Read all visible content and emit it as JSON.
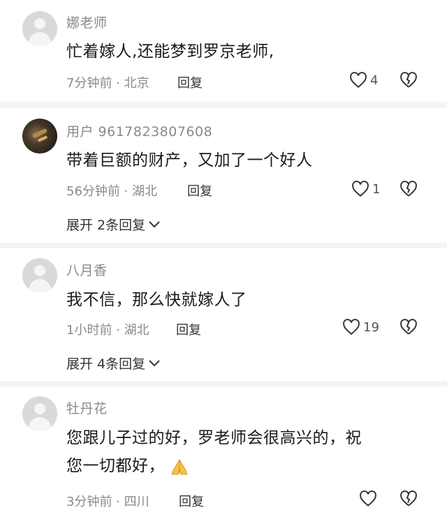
{
  "comments": [
    {
      "user": "娜老师",
      "text": "忙着嫁人,还能梦到罗京老师,",
      "meta": "7分钟前 · 北京",
      "reply": "回复",
      "likes": "4",
      "avatar": "default-avatar"
    },
    {
      "user": "用户 9617823807608",
      "text": "带着巨额的财产，又加了一个好人",
      "meta": "56分钟前 · 湖北",
      "reply": "回复",
      "likes": "1",
      "avatar": "photo-avatar",
      "expand": "展开 2条回复"
    },
    {
      "user": "八月香",
      "text": "我不信，那么快就嫁人了",
      "meta": "1小时前 · 湖北",
      "reply": "回复",
      "likes": "19",
      "avatar": "default-avatar",
      "expand": "展开 4条回复"
    },
    {
      "user": "牡丹花",
      "text_line1": "您跟儿子过的好，罗老师会很高兴的，祝",
      "text_line2": "您一切都好，",
      "emoji": "folded-hands-emoji",
      "meta": "3分钟前 · 四川",
      "reply": "回复",
      "likes": "",
      "avatar": "default-avatar"
    }
  ],
  "colors": {
    "text": "#1a1a1a",
    "meta": "#8a8a8a",
    "background": "#ffffff",
    "separator": "#f4f4f4"
  }
}
